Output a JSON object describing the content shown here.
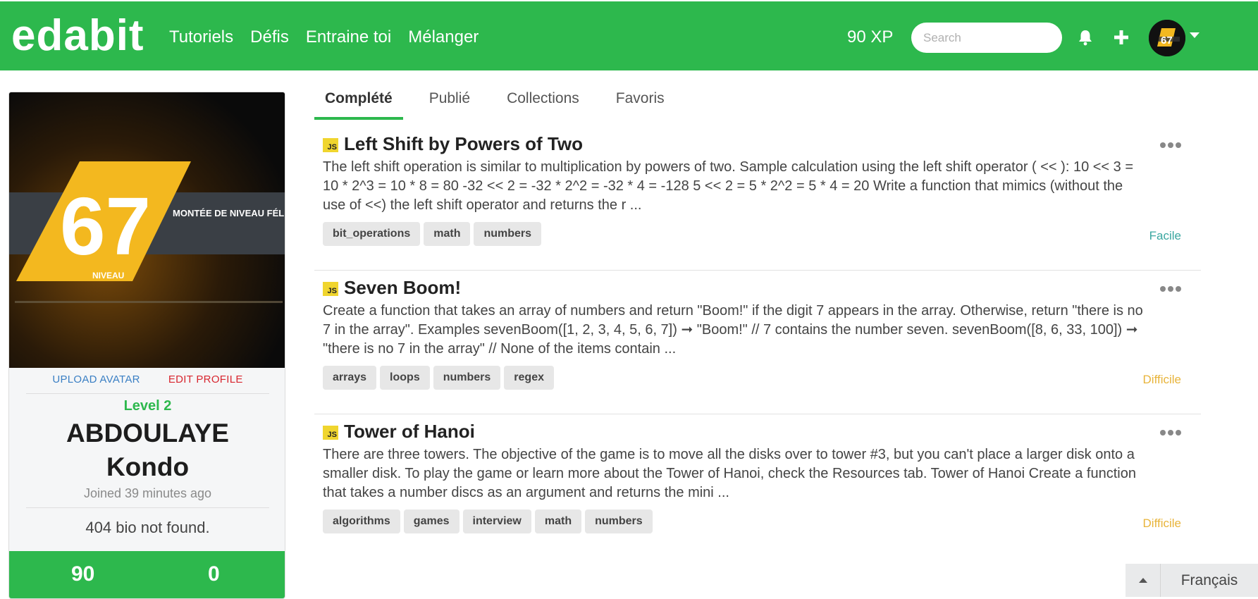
{
  "header": {
    "brand": "edabit",
    "nav": [
      "Tutoriels",
      "Défis",
      "Entraine toi",
      "Mélanger"
    ],
    "xp": "90 XP",
    "search_placeholder": "Search",
    "colors": {
      "brand_green": "#2db84d"
    },
    "icons": {
      "notifications": "bell-icon",
      "create": "plus-icon",
      "menu": "chevron-down-icon"
    }
  },
  "profile": {
    "banner_number": "67",
    "banner_text": "MONTÉE DE NIVEAU FÉLICITATIONS!",
    "banner_subtext": "NIVEAU",
    "upload_avatar": "UPLOAD AVATAR",
    "edit_profile": "EDIT PROFILE",
    "level": "Level 2",
    "name_first": "ABDOULAYE",
    "name_last": "Kondo",
    "joined": "Joined 39 minutes ago",
    "bio": "404 bio not found.",
    "stats": [
      "90",
      "0"
    ]
  },
  "tabs": [
    "Complété",
    "Publié",
    "Collections",
    "Favoris"
  ],
  "challenges": [
    {
      "lang": "JS",
      "title": "Left Shift by Powers of Two",
      "description": "The left shift operation is similar to multiplication by powers of two. Sample calculation using the left shift operator ( << ): 10 << 3 = 10 * 2^3 = 10 * 8 = 80 -32 << 2 = -32 * 2^2 = -32 * 4 = -128 5 << 2 = 5 * 2^2 = 5 * 4 = 20 Write a function that mimics (without the use of <<) the left shift operator and returns the r ...",
      "tags": [
        "bit_operations",
        "math",
        "numbers"
      ],
      "difficulty": "Facile",
      "difficulty_color": "#3aa7a0"
    },
    {
      "lang": "JS",
      "title": "Seven Boom!",
      "description": "Create a function that takes an array of numbers and return \"Boom!\" if the digit 7 appears in the array. Otherwise, return \"there is no 7 in the array\". Examples sevenBoom([1, 2, 3, 4, 5, 6, 7]) ➞ \"Boom!\" // 7 contains the number seven. sevenBoom([8, 6, 33, 100]) ➞ \"there is no 7 in the array\" // None of the items contain ...",
      "tags": [
        "arrays",
        "loops",
        "numbers",
        "regex"
      ],
      "difficulty": "Difficile",
      "difficulty_color": "#e8b43b"
    },
    {
      "lang": "JS",
      "title": "Tower of Hanoi",
      "description": "There are three towers. The objective of the game is to move all the disks over to tower #3, but you can't place a larger disk onto a smaller disk. To play the game or learn more about the Tower of Hanoi, check the Resources tab. Tower of Hanoi Create a function that takes a number discs as an argument and returns the mini ...",
      "tags": [
        "algorithms",
        "games",
        "interview",
        "math",
        "numbers"
      ],
      "difficulty": "Difficile",
      "difficulty_color": "#e8b43b"
    }
  ],
  "language_switcher": {
    "label": "Français"
  }
}
